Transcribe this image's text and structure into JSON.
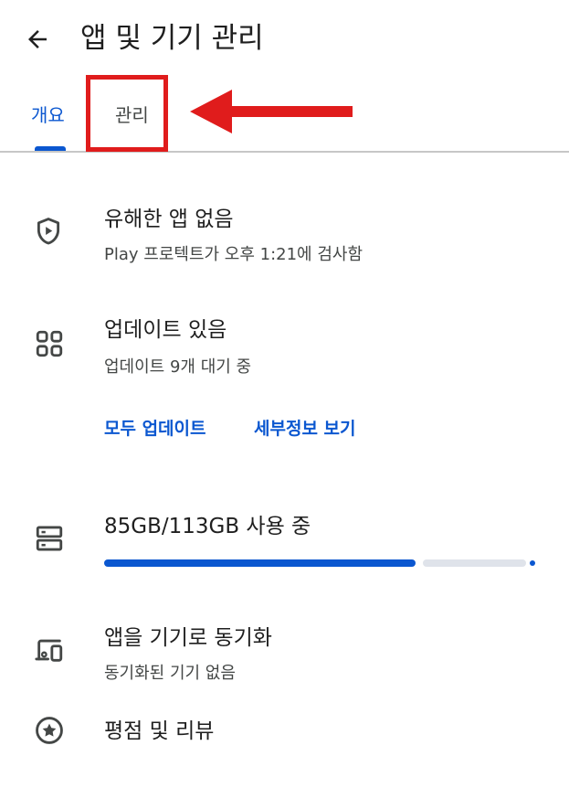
{
  "header": {
    "title": "앱 및 기기 관리",
    "back_icon": "arrow-left-icon"
  },
  "tabs": [
    {
      "label": "개요",
      "selected": true
    },
    {
      "label": "관리",
      "selected": false
    }
  ],
  "annotation": {
    "highlight_color": "#e01c1c"
  },
  "colors": {
    "accent": "#0b57d0",
    "text_primary": "#1f1f1f",
    "text_secondary": "#444746"
  },
  "items": {
    "protect": {
      "icon": "shield-play-icon",
      "title": "유해한 앱 없음",
      "subtitle": "Play 프로텍트가 오후 1:21에 검사함"
    },
    "updates": {
      "icon": "apps-grid-icon",
      "title": "업데이트 있음",
      "subtitle": "업데이트 9개 대기 중",
      "update_all": "모두 업데이트",
      "details": "세부정보 보기"
    },
    "storage": {
      "icon": "storage-icon",
      "title": "85GB/113GB 사용 중",
      "used_gb": 85,
      "total_gb": 113
    },
    "sync": {
      "icon": "devices-icon",
      "title": "앱을 기기로 동기화",
      "subtitle": "동기화된 기기 없음"
    },
    "ratings": {
      "icon": "star-circle-icon",
      "title": "평점 및 리뷰"
    }
  }
}
